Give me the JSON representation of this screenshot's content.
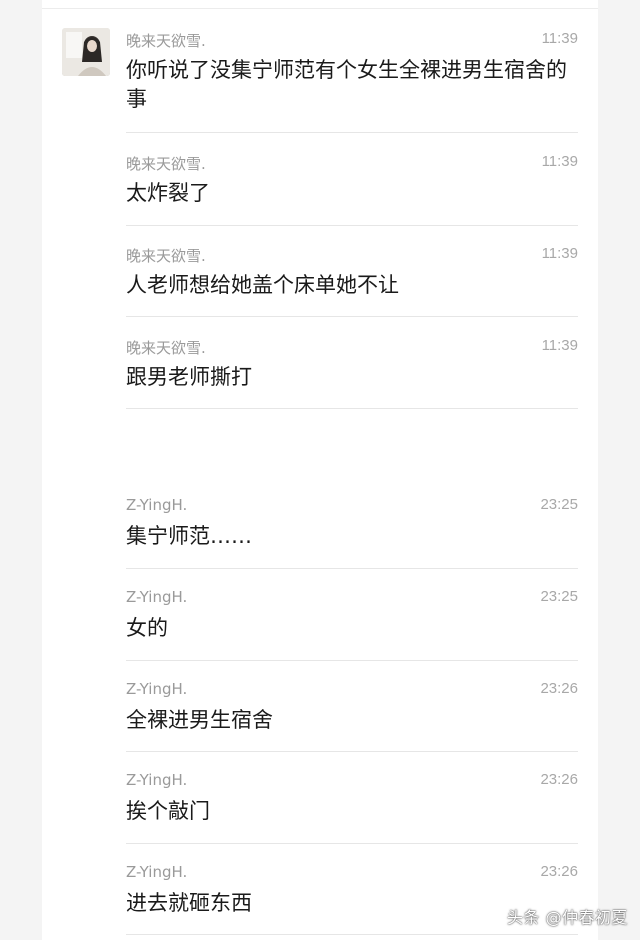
{
  "messages": [
    {
      "sender": "晚来天欲雪.",
      "time": "11:39",
      "text": "你听说了没集宁师范有个女生全裸进男生宿舍的事"
    },
    {
      "sender": "晚来天欲雪.",
      "time": "11:39",
      "text": "太炸裂了"
    },
    {
      "sender": "晚来天欲雪.",
      "time": "11:39",
      "text": "人老师想给她盖个床单她不让"
    },
    {
      "sender": "晚来天欲雪.",
      "time": "11:39",
      "text": "跟男老师撕打"
    },
    {
      "sender": "Z-YingH.",
      "time": "23:25",
      "text": "集宁师范……"
    },
    {
      "sender": "Z-YingH.",
      "time": "23:25",
      "text": "女的"
    },
    {
      "sender": "Z-YingH.",
      "time": "23:26",
      "text": "全裸进男生宿舍"
    },
    {
      "sender": "Z-YingH.",
      "time": "23:26",
      "text": "挨个敲门"
    },
    {
      "sender": "Z-YingH.",
      "time": "23:26",
      "text": "进去就砸东西"
    }
  ],
  "watermark": "头条 @仲春初夏"
}
